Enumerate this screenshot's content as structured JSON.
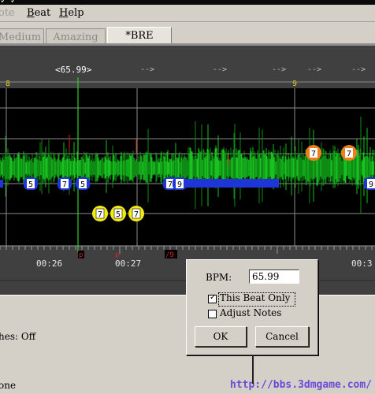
{
  "window": {
    "title_glyphs": "✓ ✓"
  },
  "menubar": {
    "items": [
      {
        "label": "ote",
        "state": "disabled"
      },
      {
        "label": "Beat",
        "accel": "B",
        "rest": "eat"
      },
      {
        "label": "Help",
        "accel": "H",
        "rest": "elp"
      }
    ]
  },
  "tabs": [
    {
      "label": "Medium",
      "active": false
    },
    {
      "label": "Amazing",
      "active": false
    },
    {
      "label": "*BRE",
      "active": true
    }
  ],
  "editor": {
    "cursor_label": "<65.99>",
    "arrows": [
      "-->",
      "-->",
      "-->",
      "-->",
      "-->"
    ],
    "beat_markers_top": [
      "8",
      "9"
    ],
    "timestamps": [
      "00:26",
      "00:27",
      "00:3"
    ],
    "playhead_markers": [
      "p",
      "p",
      "/9"
    ],
    "blue_notes": [
      "5",
      "7",
      "5",
      "7",
      "9",
      "9"
    ],
    "yellow_notes": [
      "7",
      "5",
      "7"
    ],
    "orange_notes": [
      "7",
      "7"
    ],
    "colors": {
      "waveform": "#19c21f",
      "blue_note": "#1e35d8",
      "yellow_note": "#f3ec14",
      "orange_note": "#ef7d1a"
    }
  },
  "bottom": {
    "status_line": "hes: Off",
    "status_line_2": "one"
  },
  "dialog": {
    "bpm_label": "BPM:",
    "bpm_value": "65.99",
    "this_beat_only": {
      "label": "This Beat Only",
      "checked": true
    },
    "adjust_notes": {
      "label": "Adjust Notes",
      "checked": false
    },
    "ok_label": "OK",
    "cancel_label": "Cancel"
  },
  "watermark": "http://bbs.3dmgame.com/"
}
